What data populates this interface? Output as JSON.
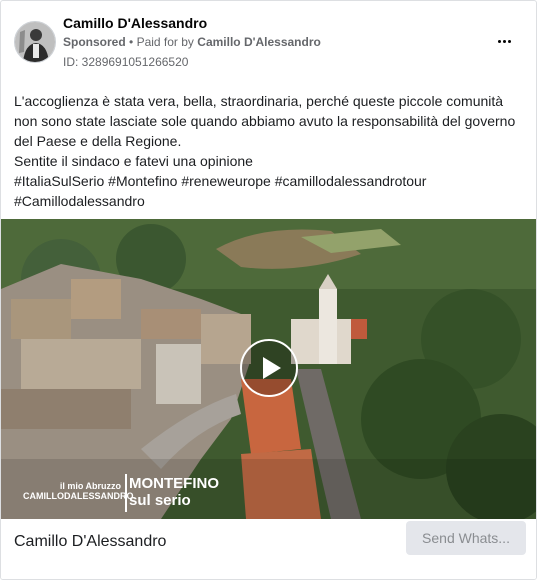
{
  "post": {
    "author": "Camillo D'Alessandro",
    "sponsored_label": "Sponsored",
    "paid_for_prefix": "Paid for by",
    "paid_for_by": "Camillo D'Alessandro",
    "ad_id": "ID: 3289691051266520",
    "more_icon": "more-horizontal-icon",
    "text_lines": [
      "L'accoglienza è stata vera, bella, straordinaria, perché queste piccole comunità non sono state lasciate sole quando abbiamo avuto la responsabilità del governo del Paese e della Regione.",
      "Sentite il sindaco e fatevi una opinione"
    ],
    "hashtags_line1": "#ItaliaSulSerio #Montefino #reneweurope #camillodalessandrotour",
    "hashtags_line2": "#Camillodalessandro"
  },
  "media": {
    "overlay_small_1": "il mio Abruzzo",
    "overlay_small_2": "CAMILLODALESSANDRO",
    "overlay_big_1": "MONTEFINO",
    "overlay_big_2": "sul serio",
    "play_icon": "play-icon"
  },
  "footer": {
    "name": "Camillo D'Alessandro",
    "cta_label": "Send Whats..."
  },
  "colors": {
    "text": "#1c1e21",
    "secondary": "#65676b",
    "cta_bg": "#e4e6eb",
    "cta_text": "#8a8d91",
    "border": "#dddfe2"
  }
}
